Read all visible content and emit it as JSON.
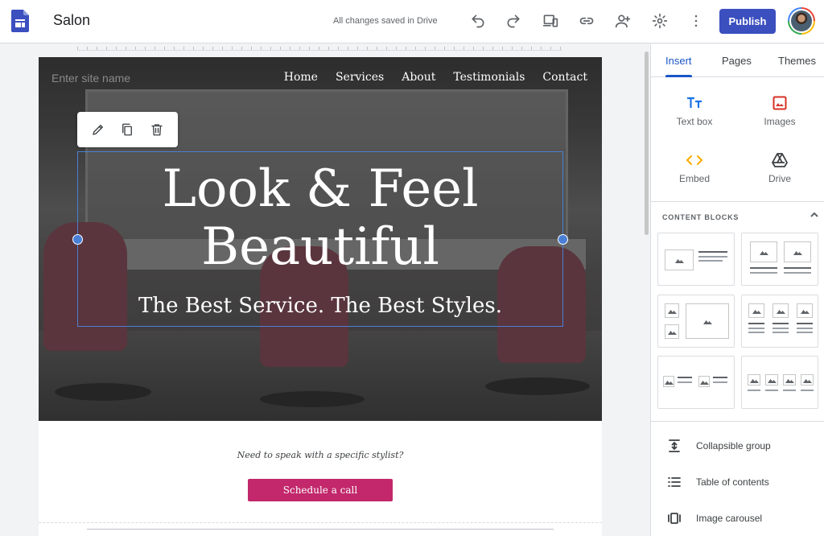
{
  "app": {
    "title": "Salon",
    "save_status": "All changes saved in Drive",
    "publish_label": "Publish"
  },
  "toolbar_icons": [
    "undo-icon",
    "redo-icon",
    "preview-device-icon",
    "link-icon",
    "share-add-person-icon",
    "settings-gear-icon",
    "more-vert-icon"
  ],
  "site": {
    "name_placeholder": "Enter site name",
    "nav": [
      "Home",
      "Services",
      "About",
      "Testimonials",
      "Contact"
    ],
    "hero_title_line1": "Look & Feel",
    "hero_title_line2": "Beautiful",
    "hero_subtitle": "The Best Service. The Best Styles.",
    "cta_text": "Need to speak with a specific stylist?",
    "cta_button": "Schedule a call",
    "cta_color": "#c2286b"
  },
  "panel": {
    "tabs": [
      "Insert",
      "Pages",
      "Themes"
    ],
    "active_tab": "Insert",
    "insert_items": [
      {
        "label": "Text box",
        "icon": "text-box-icon"
      },
      {
        "label": "Images",
        "icon": "image-icon"
      },
      {
        "label": "Embed",
        "icon": "embed-code-icon"
      },
      {
        "label": "Drive",
        "icon": "drive-icon"
      }
    ],
    "content_blocks_heading": "CONTENT BLOCKS",
    "list_items": [
      {
        "label": "Collapsible group",
        "icon": "collapsible-group-icon"
      },
      {
        "label": "Table of contents",
        "icon": "table-of-contents-icon"
      },
      {
        "label": "Image carousel",
        "icon": "image-carousel-icon"
      }
    ]
  },
  "colors": {
    "publish": "#3b4fbf",
    "accent": "#1a56c7",
    "selection": "#4a7fd6"
  }
}
